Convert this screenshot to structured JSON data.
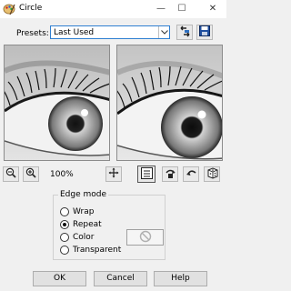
{
  "window": {
    "title": "Circle"
  },
  "presets": {
    "label": "Presets:",
    "value": "Last Used"
  },
  "zoom": {
    "level_text": "100%"
  },
  "edge_mode": {
    "title": "Edge mode",
    "options": [
      {
        "label": "Wrap",
        "checked": false
      },
      {
        "label": "Repeat",
        "checked": true
      },
      {
        "label": "Color",
        "checked": false
      },
      {
        "label": "Transparent",
        "checked": false
      }
    ]
  },
  "buttons": {
    "ok": "OK",
    "cancel": "Cancel",
    "help": "Help"
  },
  "icons": {
    "app": "paint-palette-icon",
    "minimize": "minimize-icon",
    "maximize": "maximize-icon",
    "close": "close-icon"
  },
  "colors": {
    "accent": "#2f7fd1",
    "window_bg": "#f0f0f0"
  }
}
